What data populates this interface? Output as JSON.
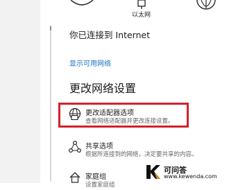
{
  "status_bar": {
    "ethernet_label": "以太网"
  },
  "status": {
    "connected_text": "你已连接到 Internet"
  },
  "links": {
    "show_networks": "显示可用网络"
  },
  "section": {
    "title": "更改网络设置"
  },
  "options": [
    {
      "icon": "adapter-globe-icon",
      "title": "更改适配器选项",
      "description": "查看网络适配器并更改连接设置。"
    },
    {
      "icon": "sharing-icon",
      "title": "共享选项",
      "description": "根据所连接到的网络，决定要共享的内容。"
    },
    {
      "icon": "homegroup-icon",
      "title": "家庭组",
      "description": "设置家庭组"
    }
  ],
  "watermark": {
    "name": "可问答",
    "url": "www.kewenda.com"
  },
  "colors": {
    "link": "#1a6fc2",
    "highlight": "#d1202b"
  }
}
